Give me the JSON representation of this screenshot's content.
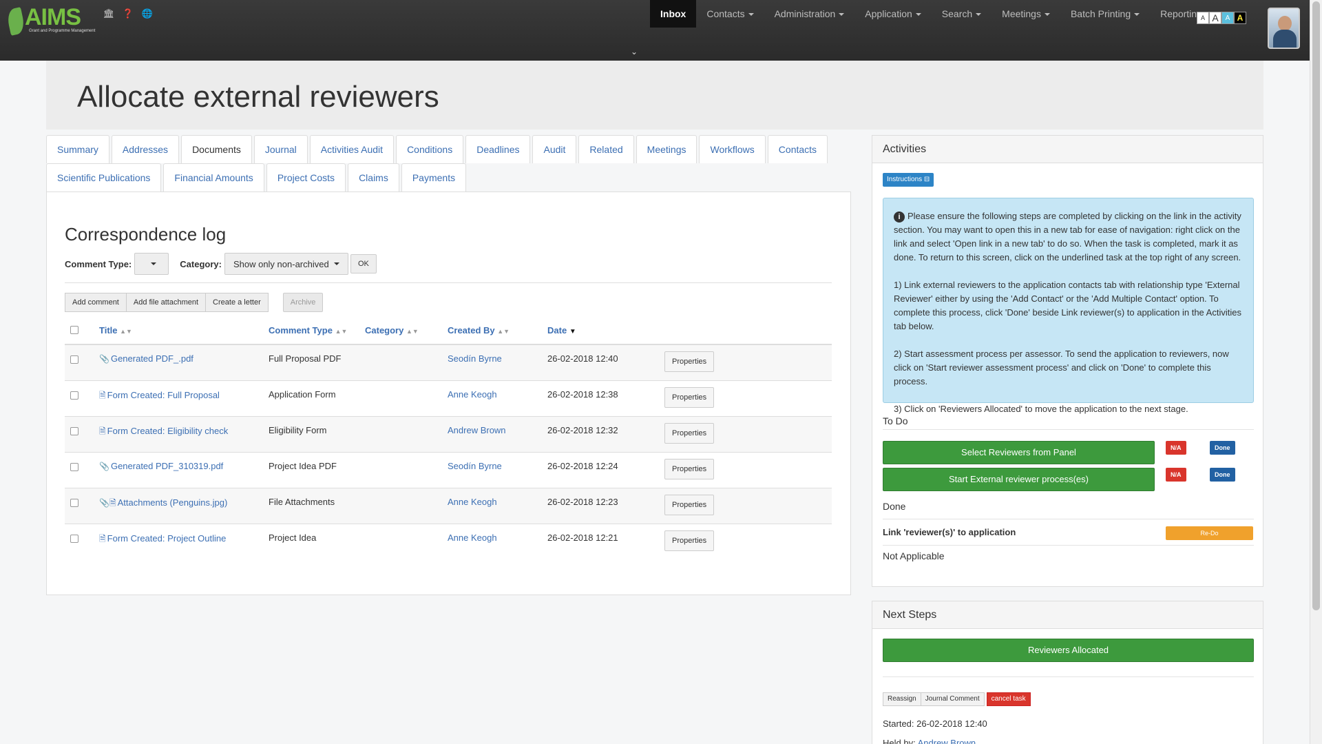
{
  "app": {
    "logo_text": "AIMS",
    "logo_subtitle": "Grant and Programme Management"
  },
  "nav": {
    "items": [
      {
        "label": "Inbox",
        "active": true,
        "dropdown": false
      },
      {
        "label": "Contacts",
        "active": false,
        "dropdown": true
      },
      {
        "label": "Administration",
        "active": false,
        "dropdown": true
      },
      {
        "label": "Application",
        "active": false,
        "dropdown": true
      },
      {
        "label": "Search",
        "active": false,
        "dropdown": true
      },
      {
        "label": "Meetings",
        "active": false,
        "dropdown": true
      },
      {
        "label": "Batch Printing",
        "active": false,
        "dropdown": true
      },
      {
        "label": "Reporting",
        "active": false,
        "dropdown": true
      }
    ],
    "font_size_options": [
      "A",
      "A",
      "A",
      "A"
    ],
    "icons": [
      "bank-icon",
      "help-icon",
      "globe-icon"
    ]
  },
  "page": {
    "title": "Allocate external reviewers"
  },
  "tabs": {
    "row1": [
      "Summary",
      "Addresses",
      "Documents",
      "Journal",
      "Activities Audit",
      "Conditions",
      "Deadlines",
      "Audit",
      "Related",
      "Meetings",
      "Workflows",
      "Contacts"
    ],
    "row2": [
      "Scientific Publications",
      "Financial Amounts",
      "Project Costs",
      "Claims",
      "Payments"
    ],
    "active": "Documents"
  },
  "log": {
    "title": "Correspondence log",
    "comment_type_label": "Comment Type:",
    "comment_type_value": "",
    "category_label": "Category:",
    "category_value": "Show only non-archived",
    "ok_label": "OK",
    "buttons": {
      "add_comment": "Add comment",
      "add_file": "Add file attachment",
      "create_letter": "Create a letter",
      "archive": "Archive"
    },
    "columns": [
      "Title",
      "Comment Type",
      "Category",
      "Created By",
      "Date"
    ],
    "properties_label": "Properties",
    "rows": [
      {
        "icon": "attach",
        "title": "Generated PDF_.pdf",
        "type": "Full Proposal PDF",
        "category": "",
        "created_by": "Seodín Byrne",
        "date": "26-02-2018 12:40"
      },
      {
        "icon": "doc",
        "title": "Form Created: Full Proposal",
        "type": "Application Form",
        "category": "",
        "created_by": "Anne Keogh",
        "date": "26-02-2018 12:38"
      },
      {
        "icon": "doc",
        "title": "Form Created: Eligibility check",
        "type": "Eligibility Form",
        "category": "",
        "created_by": "Andrew Brown",
        "date": "26-02-2018 12:32"
      },
      {
        "icon": "attach",
        "title": "Generated PDF_310319.pdf",
        "type": "Project Idea PDF",
        "category": "",
        "created_by": "Seodín Byrne",
        "date": "26-02-2018 12:24"
      },
      {
        "icon": "attach-doc",
        "title": "Attachments (Penguins.jpg)",
        "type": "File Attachments",
        "category": "",
        "created_by": "Anne Keogh",
        "date": "26-02-2018 12:23"
      },
      {
        "icon": "doc",
        "title": "Form Created: Project Outline",
        "type": "Project Idea",
        "category": "",
        "created_by": "Anne Keogh",
        "date": "26-02-2018 12:21"
      }
    ]
  },
  "activities": {
    "title": "Activities",
    "instructions_label": "Instructions",
    "info_paragraphs": [
      "Please ensure the following steps are completed by clicking on the link in the activity section. You may want to open this in a new tab for ease of navigation: right click on the link and select 'Open link in a new tab' to do so. When the task is completed, mark it as done. To return to this screen, click on the underlined task at the top right of any screen.",
      "1) Link external reviewers to the application contacts tab with relationship type 'External Reviewer' either by using the 'Add Contact' or the 'Add Multiple Contact' option. To complete this process, click 'Done' beside Link reviewer(s) to application in the Activities tab below.",
      "2) Start assessment process per assessor. To send the application to reviewers, now click on 'Start reviewer assessment process' and click on 'Done' to complete this process.",
      "3) Click on 'Reviewers Allocated' to move the application to the next stage."
    ],
    "todo_label": "To Do",
    "todo_items": [
      {
        "label": "Select Reviewers from Panel",
        "na": "N/A",
        "done": "Done"
      },
      {
        "label": "Start External reviewer process(es)",
        "na": "N/A",
        "done": "Done"
      }
    ],
    "done_label": "Done",
    "done_items": [
      {
        "label": "Link 'reviewer(s)' to application",
        "redo": "Re-Do"
      }
    ],
    "not_applicable_label": "Not Applicable"
  },
  "next_steps": {
    "title": "Next Steps",
    "primary": "Reviewers Allocated",
    "reassign": "Reassign",
    "journal_comment": "Journal Comment",
    "cancel_task": "cancel task",
    "started": "Started: 26-02-2018 12:40",
    "held_by_label": "Held by:",
    "held_by_name": "Andrew Brown"
  },
  "colors": {
    "link": "#3c6fb3",
    "green": "#3d9a3d",
    "red": "#d9352c",
    "blue": "#2261a3",
    "orange": "#f0a12c",
    "info_bg": "#c6e6f5"
  }
}
